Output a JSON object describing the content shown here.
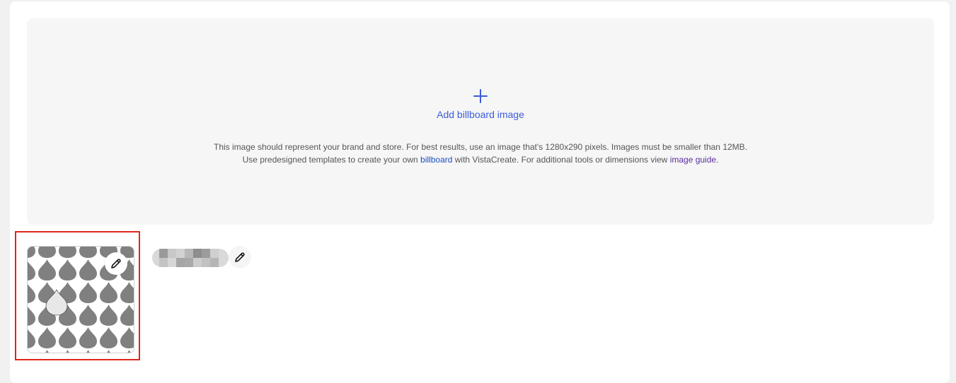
{
  "billboard": {
    "add_label": "Add billboard image",
    "help_line1": "This image should represent your brand and store. For best results, use an image that's 1280x290 pixels. Images must be smaller than 12MB.",
    "help_line2_prefix": "Use predesigned templates to create your own ",
    "billboard_link": "billboard",
    "help_line2_middle": " with VistaCreate. For additional tools or dimensions view ",
    "guide_link": "image guide",
    "help_line2_suffix": "."
  },
  "icons": {
    "add": "plus-icon",
    "edit": "pencil-icon"
  },
  "colors": {
    "accent": "#3b5bdb",
    "highlight": "#e0261e",
    "link_visited": "#5a2d9c"
  }
}
